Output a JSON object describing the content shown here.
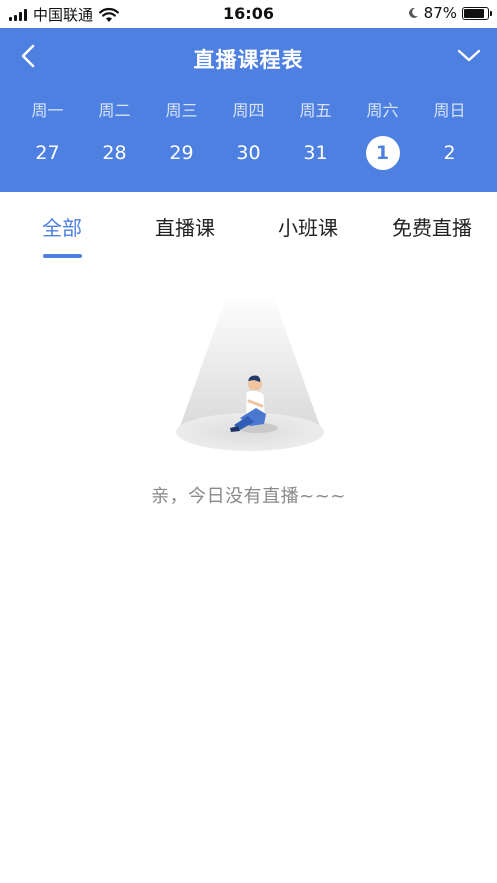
{
  "status_bar": {
    "carrier": "中国联通",
    "time": "16:06",
    "battery_percent": "87%",
    "battery_level": 0.87
  },
  "header": {
    "title": "直播课程表",
    "back_icon": "chevron-left-icon",
    "dropdown_icon": "chevron-down-icon",
    "accent_color": "#4d80e0"
  },
  "week": {
    "days": [
      {
        "weekday": "周一",
        "date": "27",
        "selected": false
      },
      {
        "weekday": "周二",
        "date": "28",
        "selected": false
      },
      {
        "weekday": "周三",
        "date": "29",
        "selected": false
      },
      {
        "weekday": "周四",
        "date": "30",
        "selected": false
      },
      {
        "weekday": "周五",
        "date": "31",
        "selected": false
      },
      {
        "weekday": "周六",
        "date": "1",
        "selected": true
      },
      {
        "weekday": "周日",
        "date": "2",
        "selected": false
      }
    ]
  },
  "tabs": [
    {
      "label": "全部",
      "active": true
    },
    {
      "label": "直播课",
      "active": false
    },
    {
      "label": "小班课",
      "active": false
    },
    {
      "label": "免费直播",
      "active": false
    }
  ],
  "empty_state": {
    "message": "亲，今日没有直播~~~",
    "illustration": "person-in-spotlight-illustration"
  }
}
